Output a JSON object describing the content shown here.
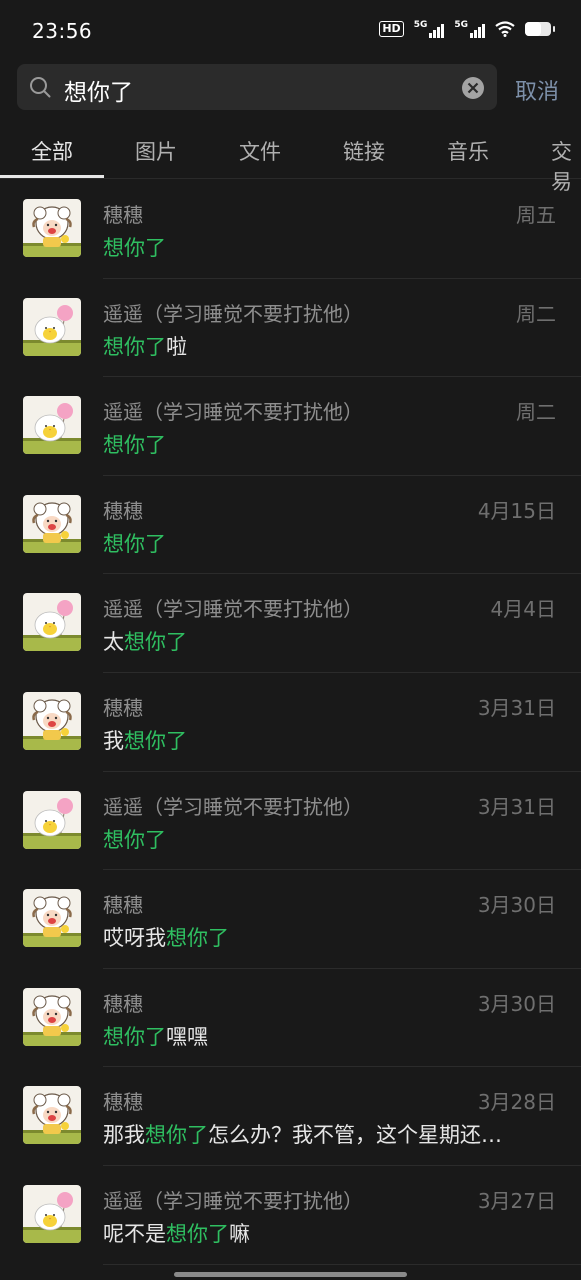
{
  "status": {
    "time": "23:56",
    "hd": "HD",
    "sig1": "5G",
    "sig2": "5G",
    "battery_level": 0.62
  },
  "search": {
    "query": "想你了",
    "cancel": "取消"
  },
  "tabs": [
    "全部",
    "图片",
    "文件",
    "链接",
    "音乐",
    "交易"
  ],
  "active_tab_index": 0,
  "results": [
    {
      "name": "穗穗",
      "date": "周五",
      "pre": "",
      "hl": "想你了",
      "post": "",
      "avatar": "sheep"
    },
    {
      "name": "遥遥（学习睡觉不要打扰他）",
      "date": "周二",
      "pre": "",
      "hl": "想你了",
      "post": "啦",
      "avatar": "chick"
    },
    {
      "name": "遥遥（学习睡觉不要打扰他）",
      "date": "周二",
      "pre": "",
      "hl": "想你了",
      "post": "",
      "avatar": "chick"
    },
    {
      "name": "穗穗",
      "date": "4月15日",
      "pre": "",
      "hl": "想你了",
      "post": "",
      "avatar": "sheep"
    },
    {
      "name": "遥遥（学习睡觉不要打扰他）",
      "date": "4月4日",
      "pre": "太",
      "hl": "想你了",
      "post": "",
      "avatar": "chick"
    },
    {
      "name": "穗穗",
      "date": "3月31日",
      "pre": "我",
      "hl": "想你了",
      "post": "",
      "avatar": "sheep"
    },
    {
      "name": "遥遥（学习睡觉不要打扰他）",
      "date": "3月31日",
      "pre": "",
      "hl": "想你了",
      "post": "",
      "avatar": "chick"
    },
    {
      "name": "穗穗",
      "date": "3月30日",
      "pre": "哎呀我",
      "hl": "想你了",
      "post": "",
      "avatar": "sheep"
    },
    {
      "name": "穗穗",
      "date": "3月30日",
      "pre": "",
      "hl": "想你了",
      "post": "嘿嘿",
      "avatar": "sheep"
    },
    {
      "name": "穗穗",
      "date": "3月28日",
      "pre": "那我",
      "hl": "想你了",
      "post": "怎么办？我不管，这个星期还…",
      "avatar": "sheep"
    },
    {
      "name": "遥遥（学习睡觉不要打扰他）",
      "date": "3月27日",
      "pre": "呢不是",
      "hl": "想你了",
      "post": "嘛",
      "avatar": "chick"
    }
  ],
  "colors": {
    "highlight": "#2fbf61",
    "cancel": "#7d90a9",
    "background": "#191919"
  }
}
